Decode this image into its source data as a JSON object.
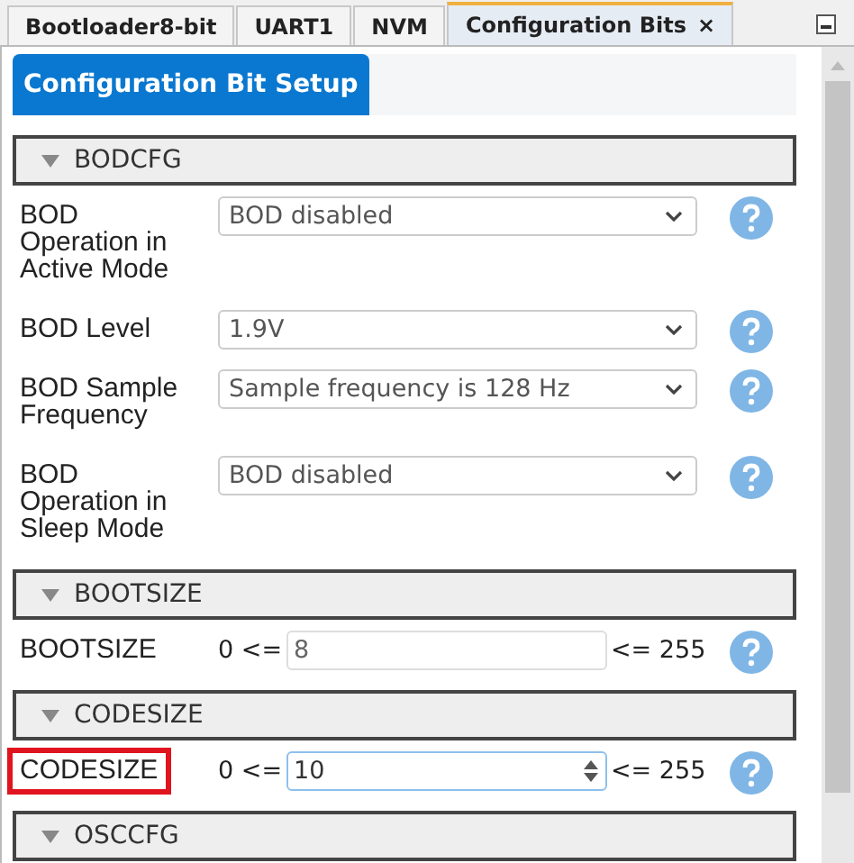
{
  "tabs": [
    {
      "label": "Bootloader8-bit",
      "selected": false,
      "closable": false
    },
    {
      "label": "UART1",
      "selected": false,
      "closable": false
    },
    {
      "label": "NVM",
      "selected": false,
      "closable": false
    },
    {
      "label": "Configuration Bits",
      "selected": true,
      "closable": true
    }
  ],
  "close_glyph": "×",
  "inner_tab": {
    "label": "Configuration Bit Setup",
    "selected": true
  },
  "sections": [
    {
      "title": "BODCFG",
      "expanded": true,
      "settings": [
        {
          "kind": "select",
          "label": "BOD Operation in Active Mode",
          "value": "BOD disabled"
        },
        {
          "kind": "select",
          "label": "BOD Level",
          "value": "1.9V"
        },
        {
          "kind": "select",
          "label": "BOD Sample Frequency",
          "value": "Sample frequency is 128 Hz"
        },
        {
          "kind": "select",
          "label": "BOD Operation in Sleep Mode",
          "value": "BOD disabled"
        }
      ]
    },
    {
      "title": "BOOTSIZE",
      "expanded": true,
      "settings": [
        {
          "kind": "number",
          "label": "BOOTSIZE",
          "min_text": "0 <=",
          "value": "8",
          "max_text": "<= 255",
          "focused": false,
          "highlighted": false
        }
      ]
    },
    {
      "title": "CODESIZE",
      "expanded": true,
      "settings": [
        {
          "kind": "number",
          "label": "CODESIZE",
          "min_text": "0 <=",
          "value": "10",
          "max_text": "<= 255",
          "focused": true,
          "highlighted": true
        }
      ]
    },
    {
      "title": "OSCCFG",
      "expanded": true
    }
  ]
}
